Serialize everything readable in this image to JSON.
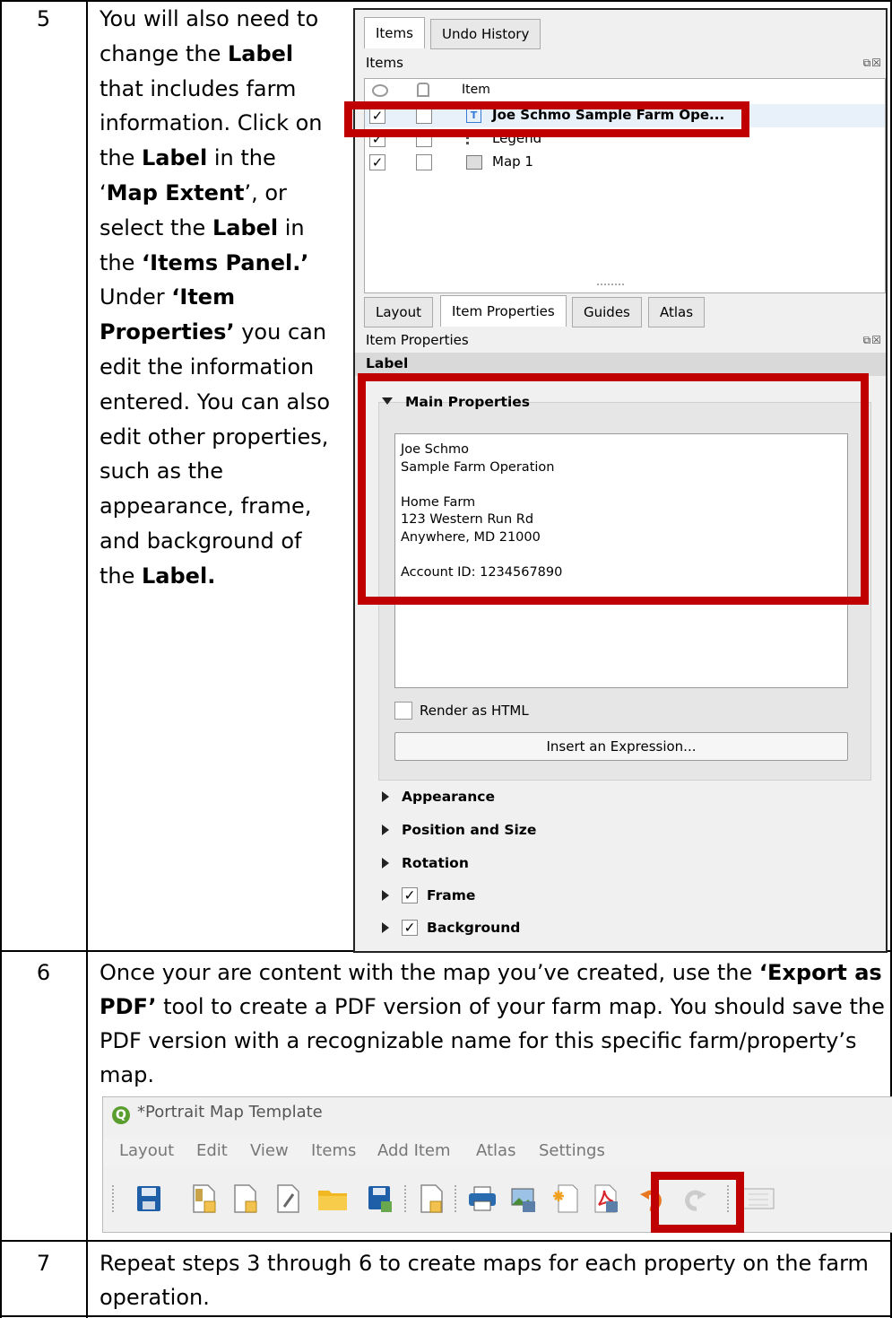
{
  "steps": [
    {
      "number": "5",
      "segments": [
        {
          "text": "You will also need to change the ",
          "bold": false
        },
        {
          "text": "Label",
          "bold": true
        },
        {
          "text": " that includes farm information. Click on the ",
          "bold": false
        },
        {
          "text": "Label",
          "bold": true
        },
        {
          "text": " in the ‘",
          "bold": false
        },
        {
          "text": "Map Extent",
          "bold": true
        },
        {
          "text": "’, or select the ",
          "bold": false
        },
        {
          "text": "Label",
          "bold": true
        },
        {
          "text": " in the ",
          "bold": false
        },
        {
          "text": "‘Items Panel.’",
          "bold": true
        },
        {
          "text": " Under ",
          "bold": false
        },
        {
          "text": "‘Item Properties’",
          "bold": true
        },
        {
          "text": " you can edit the information entered.  You can also edit other properties, such as the appearance, frame, and background of the ",
          "bold": false
        },
        {
          "text": "Label.",
          "bold": true
        }
      ]
    },
    {
      "number": "6",
      "segments": [
        {
          "text": "Once your are content with the map you’ve created, use the ",
          "bold": false
        },
        {
          "text": "‘Export as PDF’",
          "bold": true
        },
        {
          "text": " tool to create a PDF version of your farm map. You should save the PDF version with a recognizable name for this specific farm/property’s map.",
          "bold": false
        }
      ]
    },
    {
      "number": "7",
      "segments": [
        {
          "text": "Repeat steps 3 through 6 to create maps for each property on the farm operation.",
          "bold": false
        }
      ]
    }
  ],
  "items_panel": {
    "tabs": [
      "Items",
      "Undo History"
    ],
    "title": "Items",
    "column_header": "Item",
    "rows": [
      {
        "label": "Joe Schmo Sample Farm Ope...",
        "visible": true,
        "locked": false,
        "icon": "text-label-icon",
        "selected": true
      },
      {
        "label": "Legend",
        "visible": true,
        "locked": false,
        "icon": "legend-icon",
        "selected": false
      },
      {
        "label": "Map 1",
        "visible": true,
        "locked": false,
        "icon": "map-icon",
        "selected": false
      }
    ],
    "check_mark": "✓"
  },
  "properties_panel": {
    "tabs": [
      "Layout",
      "Item Properties",
      "Guides",
      "Atlas"
    ],
    "title": "Item Properties",
    "item_type": "Label",
    "main_section": "Main Properties",
    "label_text": [
      "Joe Schmo",
      "Sample Farm Operation",
      "",
      "Home Farm",
      "123 Western Run Rd",
      "Anywhere, MD 21000",
      "",
      "Account ID: 1234567890"
    ],
    "render_html": "Render as HTML",
    "insert_button": "Insert an Expression...",
    "collapsed_sections": [
      {
        "label": "Appearance",
        "checkbox": false
      },
      {
        "label": "Position and Size",
        "checkbox": false
      },
      {
        "label": "Rotation",
        "checkbox": false
      },
      {
        "label": "Frame",
        "checkbox": true
      },
      {
        "label": "Background",
        "checkbox": true
      }
    ]
  },
  "toolbar_window": {
    "title": "*Portrait Map Template",
    "menus": [
      "Layout",
      "Edit",
      "View",
      "Items",
      "Add Item",
      "Atlas",
      "Settings"
    ],
    "tools": [
      "save-icon",
      "new-layout-icon",
      "duplicate-layout-icon",
      "layout-manager-icon",
      "open-folder-icon",
      "save-template-icon",
      "new-page-icon",
      "print-icon",
      "export-image-icon",
      "export-svg-icon",
      "export-pdf-icon",
      "undo-icon",
      "redo-icon",
      "atlas-icon"
    ]
  },
  "colors": {
    "highlight": "#c00000",
    "pdf_red": "#d9262c",
    "undo_orange": "#e87722",
    "save_blue": "#1f5fa8"
  }
}
